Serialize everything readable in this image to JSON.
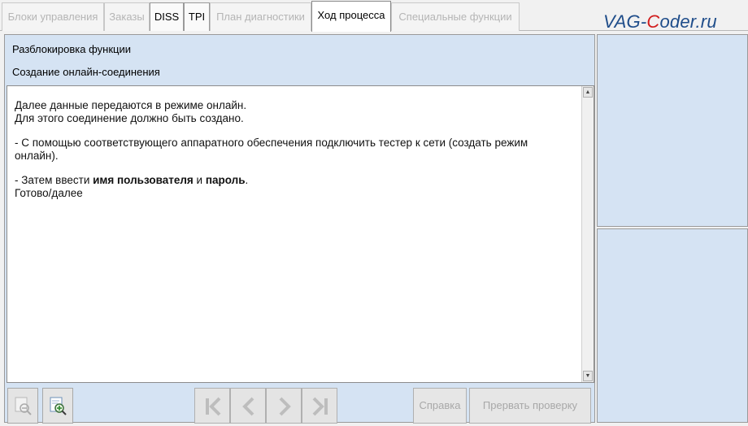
{
  "tabs": [
    {
      "label": "Блоки управления",
      "state": "disabled"
    },
    {
      "label": "Заказы",
      "state": "disabled"
    },
    {
      "label": "DISS",
      "state": "enabled"
    },
    {
      "label": "TPI",
      "state": "enabled"
    },
    {
      "label": "План диагностики",
      "state": "disabled"
    },
    {
      "label": "Ход процесса",
      "state": "active"
    },
    {
      "label": "Специальные функции",
      "state": "disabled"
    }
  ],
  "watermark": {
    "part1": "VAG-",
    "part2": "C",
    "part3": "oder.ru"
  },
  "header": {
    "line1": "Разблокировка функции",
    "line2": "Создание онлайн-соединения"
  },
  "content": {
    "p1_line1": "Далее данные передаются в режиме онлайн.",
    "p1_line2": "Для этого соединение должно быть создано.",
    "p2_line1": "- С помощью соответствующего аппаратного обеспечения подключить тестер к сети (создать режим",
    "p2_line2": "онлайн).",
    "p3_prefix": "- Затем ввести ",
    "p3_bold1": "имя пользователя",
    "p3_mid": " и ",
    "p3_bold2": "пароль",
    "p3_suffix": ".",
    "p4": "Готово/далее"
  },
  "toolbar": {
    "help_label": "Справка",
    "abort_label": "Прервать проверку",
    "zoom_out_icon": "zoom-out-icon",
    "zoom_in_icon": "zoom-in-icon",
    "first_icon": "first-page-icon",
    "prev_icon": "previous-icon",
    "next_icon": "next-icon",
    "last_icon": "last-page-icon"
  },
  "colors": {
    "panel_bg": "#d5e3f3",
    "content_bg": "#ffffff",
    "watermark_blue": "#1f4d8a",
    "watermark_red": "#d11c1c"
  }
}
